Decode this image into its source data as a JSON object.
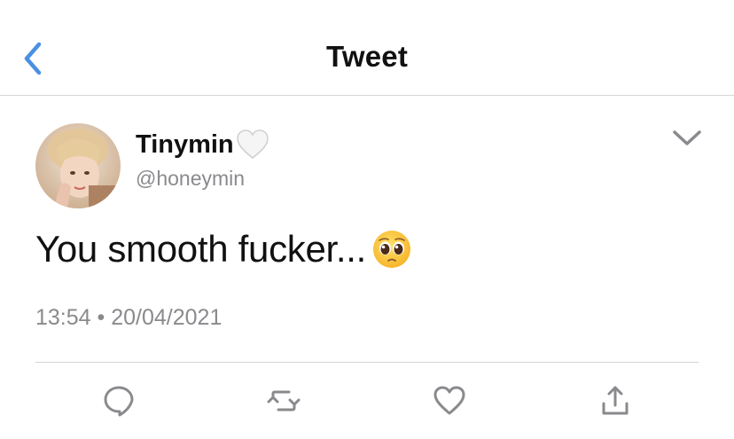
{
  "header": {
    "title": "Tweet",
    "back_icon": "chevron-left-icon"
  },
  "tweet": {
    "author": {
      "display_name": "Tinymin",
      "name_emoji": "white-heart",
      "handle": "@honeymin"
    },
    "text": "You smooth fucker...",
    "text_emoji": "pleading-face",
    "time": "13:54",
    "separator": "•",
    "date": "20/04/2021"
  },
  "actions": {
    "reply_icon": "reply-icon",
    "retweet_icon": "retweet-icon",
    "like_icon": "heart-icon",
    "share_icon": "share-icon"
  },
  "colors": {
    "accent": "#4a90e2",
    "icon_gray": "#8a8a8e",
    "divider": "#d6d6d6"
  }
}
